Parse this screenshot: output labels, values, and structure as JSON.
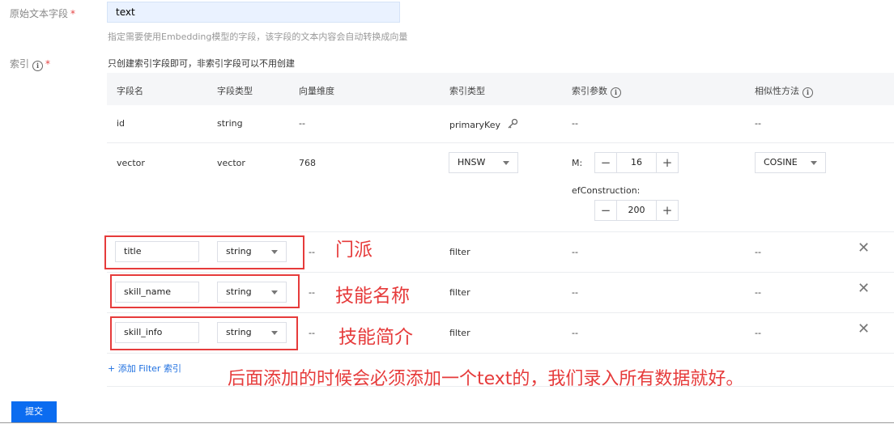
{
  "form": {
    "source_field_label": "原始文本字段",
    "source_field_required": "*",
    "source_field_value": "text",
    "source_field_hint": "指定需要使用Embedding模型的字段，该字段的文本内容会自动转换成向量",
    "index_label": "索引",
    "index_required": "*",
    "index_hint": "只创建索引字段即可，非索引字段可以不用创建",
    "info_glyph": "i"
  },
  "table": {
    "headers": [
      "字段名",
      "字段类型",
      "向量维度",
      "索引类型",
      "索引参数",
      "相似性方法"
    ],
    "rows": {
      "id": {
        "name": "id",
        "type": "string",
        "dim": "--",
        "index_type": "primaryKey",
        "params": "--",
        "similarity": "--"
      },
      "vector": {
        "name": "vector",
        "type": "vector",
        "dim": "768",
        "index_type": "HNSW",
        "m_label": "M:",
        "m_value": "16",
        "ef_label": "efConstruction:",
        "ef_value": "200",
        "similarity": "COSINE"
      },
      "filters": [
        {
          "name": "title",
          "type": "string",
          "dim": "--",
          "index_type": "filter",
          "params": "--",
          "similarity": "--"
        },
        {
          "name": "skill_name",
          "type": "string",
          "dim": "--",
          "index_type": "filter",
          "params": "--",
          "similarity": "--"
        },
        {
          "name": "skill_info",
          "type": "string",
          "dim": "--",
          "index_type": "filter",
          "params": "--",
          "similarity": "--"
        }
      ]
    },
    "stepper_minus": "−",
    "stepper_plus": "+",
    "remove_glyph": "✕"
  },
  "add_filter_link": "+ 添加 Filter 索引",
  "submit_label": "提交",
  "annotations": {
    "title": "门派",
    "skill_name": "技能名称",
    "skill_info": "技能简介",
    "note": "后面添加的时候会必须添加一个text的，我们录入所有数据就好。"
  },
  "colors": {
    "accent": "#0b6cf0",
    "annotation_red": "#e63b3b",
    "field_bg": "#eaf2ff"
  }
}
